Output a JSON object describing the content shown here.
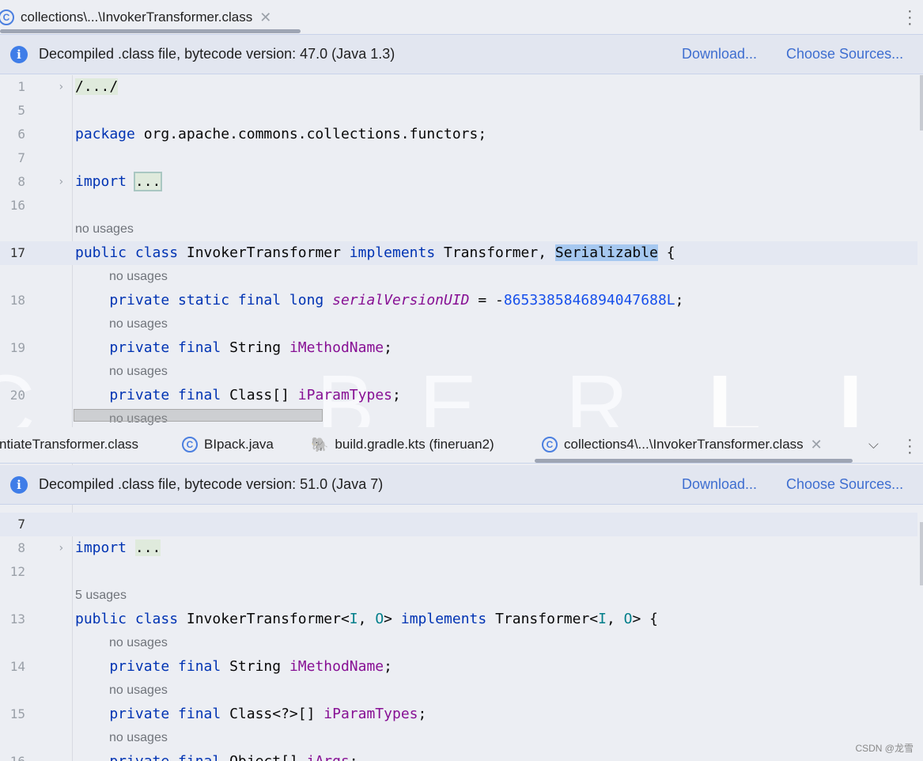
{
  "top": {
    "tab": {
      "label": "collections\\...\\InvokerTransformer.class",
      "icon": "class-icon"
    },
    "banner": {
      "text": "Decompiled .class file, bytecode version: 47.0 (Java 1.3)",
      "download": "Download...",
      "choose_sources": "Choose Sources..."
    },
    "lines": [
      {
        "n": "1",
        "fold": true,
        "tokens": [
          {
            "t": "/.../",
            "c": "d fb"
          }
        ]
      },
      {
        "n": "5",
        "tokens": []
      },
      {
        "n": "6",
        "tokens": [
          {
            "t": "package",
            "c": "k"
          },
          {
            "t": " org.apache.commons.collections.functors;",
            "c": "d"
          }
        ]
      },
      {
        "n": "7",
        "tokens": []
      },
      {
        "n": "8",
        "fold": true,
        "tokens": [
          {
            "t": "import",
            "c": "k"
          },
          {
            "t": " ",
            "c": "d"
          },
          {
            "t": "...",
            "c": "d fbb"
          }
        ]
      },
      {
        "n": "16",
        "tokens": []
      },
      {
        "hint": "no usages"
      },
      {
        "n": "17",
        "cur": true,
        "tokens": [
          {
            "t": "public class",
            "c": "k"
          },
          {
            "t": " InvokerTransformer ",
            "c": "d"
          },
          {
            "t": "implements",
            "c": "k"
          },
          {
            "t": " Transformer, ",
            "c": "d"
          },
          {
            "t": "Serializable",
            "c": "d sel"
          },
          {
            "t": " {",
            "c": "d"
          }
        ]
      },
      {
        "hint": "no usages",
        "indent": true
      },
      {
        "n": "18",
        "tokens": [
          {
            "t": "    private static final long",
            "c": "k"
          },
          {
            "t": " ",
            "c": "d"
          },
          {
            "t": "serialVersionUID",
            "c": "fi"
          },
          {
            "t": " = -",
            "c": "d"
          },
          {
            "t": "8653385846894047688L",
            "c": "n"
          },
          {
            "t": ";",
            "c": "d"
          }
        ]
      },
      {
        "hint": "no usages",
        "indent": true
      },
      {
        "n": "19",
        "tokens": [
          {
            "t": "    private final",
            "c": "k"
          },
          {
            "t": " String ",
            "c": "d"
          },
          {
            "t": "iMethodName",
            "c": "f"
          },
          {
            "t": ";",
            "c": "d"
          }
        ]
      },
      {
        "hint": "no usages",
        "indent": true
      },
      {
        "n": "20",
        "tokens": [
          {
            "t": "    private final",
            "c": "k"
          },
          {
            "t": " Class[] ",
            "c": "d"
          },
          {
            "t": "iParamTypes",
            "c": "f"
          },
          {
            "t": ";",
            "c": "d"
          }
        ]
      },
      {
        "hint": "no usages",
        "indent": true
      }
    ]
  },
  "bottom": {
    "tabs": [
      {
        "label": "ntiateTransformer.class",
        "icon": "none"
      },
      {
        "label": "BIpack.java",
        "icon": "class-icon"
      },
      {
        "label": "build.gradle.kts (fineruan2)",
        "icon": "gradle-icon"
      },
      {
        "label": "collections4\\...\\InvokerTransformer.class",
        "icon": "class-icon"
      }
    ],
    "banner": {
      "text": "Decompiled .class file, bytecode version: 51.0 (Java 7)",
      "download": "Download...",
      "choose_sources": "Choose Sources..."
    },
    "lines": [
      {
        "n": "7",
        "cur": true,
        "tokens": []
      },
      {
        "n": "8",
        "fold": true,
        "tokens": [
          {
            "t": "import",
            "c": "k"
          },
          {
            "t": " ",
            "c": "d"
          },
          {
            "t": "...",
            "c": "d fb"
          }
        ]
      },
      {
        "n": "12",
        "tokens": []
      },
      {
        "hint": "5 usages"
      },
      {
        "n": "13",
        "tokens": [
          {
            "t": "public class",
            "c": "k"
          },
          {
            "t": " InvokerTransformer<",
            "c": "d"
          },
          {
            "t": "I",
            "c": "t"
          },
          {
            "t": ", ",
            "c": "d"
          },
          {
            "t": "O",
            "c": "t"
          },
          {
            "t": "> ",
            "c": "d"
          },
          {
            "t": "implements",
            "c": "k"
          },
          {
            "t": " Transformer<",
            "c": "d"
          },
          {
            "t": "I",
            "c": "t"
          },
          {
            "t": ", ",
            "c": "d"
          },
          {
            "t": "O",
            "c": "t"
          },
          {
            "t": "> {",
            "c": "d"
          }
        ]
      },
      {
        "hint": "no usages",
        "indent": true
      },
      {
        "n": "14",
        "tokens": [
          {
            "t": "    private final",
            "c": "k"
          },
          {
            "t": " String ",
            "c": "d"
          },
          {
            "t": "iMethodName",
            "c": "f"
          },
          {
            "t": ";",
            "c": "d"
          }
        ]
      },
      {
        "hint": "no usages",
        "indent": true
      },
      {
        "n": "15",
        "tokens": [
          {
            "t": "    private final",
            "c": "k"
          },
          {
            "t": " Class<?>[] ",
            "c": "d"
          },
          {
            "t": "iParamTypes",
            "c": "f"
          },
          {
            "t": ";",
            "c": "d"
          }
        ]
      },
      {
        "hint": "no usages",
        "indent": true
      },
      {
        "n": "16",
        "tokens": [
          {
            "t": "    private final",
            "c": "k"
          },
          {
            "t": " Object[] ",
            "c": "d"
          },
          {
            "t": "iArgs",
            "c": "f"
          },
          {
            "t": ";",
            "c": "d"
          }
        ]
      }
    ]
  },
  "watermark": {
    "letters": [
      "C",
      "Y",
      "B",
      "E",
      "R",
      "L",
      "I"
    ],
    "csdn": "CSDN @龙雪"
  }
}
